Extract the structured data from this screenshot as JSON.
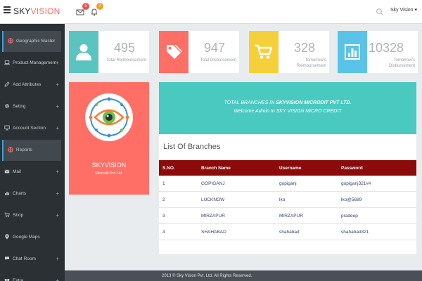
{
  "header": {
    "brand_part1": "SKY",
    "brand_part2": "VISION",
    "mail_count": "5",
    "bell_count": "7",
    "user_menu": "Sky Vision ▾"
  },
  "sidebar": {
    "items": [
      {
        "label": "Geographic Master",
        "icon": "globe-icon",
        "active": true,
        "expandable": false
      },
      {
        "label": "Product Management",
        "icon": "laptop-icon",
        "active": false,
        "expandable": true
      },
      {
        "label": "Add Attributes",
        "icon": "pencil-icon",
        "active": false,
        "expandable": true
      },
      {
        "label": "Seting",
        "icon": "gear-icon",
        "active": false,
        "expandable": true
      },
      {
        "label": "Account Section",
        "icon": "monitor-icon",
        "active": false,
        "expandable": true
      },
      {
        "label": "Reports",
        "icon": "globe-icon",
        "active": true,
        "expandable": false
      },
      {
        "label": "Mail",
        "icon": "envelope-icon",
        "active": false,
        "expandable": true
      },
      {
        "label": "Charts",
        "icon": "bar-chart-icon",
        "active": false,
        "expandable": true
      },
      {
        "label": "Shop",
        "icon": "cart-icon",
        "active": false,
        "expandable": true
      },
      {
        "label": "Google Maps",
        "icon": "map-pin-icon",
        "active": false,
        "expandable": false
      },
      {
        "label": "Chat Room",
        "icon": "chat-icon",
        "active": false,
        "expandable": true
      },
      {
        "label": "Extra",
        "icon": "gift-icon",
        "active": false,
        "expandable": true
      }
    ]
  },
  "stats": [
    {
      "value": "495",
      "label": "Total Reimbursement",
      "color": "#5cc4c0",
      "icon": "user-icon"
    },
    {
      "value": "947",
      "label": "Total Disbursement",
      "color": "#ff6f66",
      "icon": "tag-icon"
    },
    {
      "value": "328",
      "label": "Tomorrow's Reimbursement",
      "color": "#f5d03a",
      "icon": "cart-icon"
    },
    {
      "value": "10328",
      "label": "Tomorrow's Disbursement",
      "color": "#5ac3e8",
      "icon": "bar-chart-icon"
    }
  ],
  "profile": {
    "name": "SKYVISION",
    "subtitle": "Microdit Pvt Ltd.",
    "color": "#ff6f66"
  },
  "banner": {
    "line1_prefix": "TOTAL BRANCHES IN ",
    "line1_bold": "SKYVISION MICRODIT PVT LTD.",
    "line2": "Welcome Admin In SKY VISION MICRO CREDIT",
    "color": "#49c9c0"
  },
  "branches": {
    "title": "List Of Branches",
    "columns": [
      "S.NO.",
      "Branch Name",
      "Username",
      "Password"
    ],
    "rows": [
      [
        "1",
        "GOPIGANJ",
        "gopiganj",
        "gopiganj321##"
      ],
      [
        "2",
        "LUCKNOW",
        "lko",
        "lko@5689"
      ],
      [
        "3",
        "MIRZAPUR",
        "MIRZAPUR",
        "pradeep"
      ],
      [
        "4",
        "SHAHABAD",
        "shahabad",
        "shahabad321"
      ]
    ],
    "header_color": "#8b0a0a"
  },
  "footer": {
    "text": "2013 © Sky Vision Pvt. Ltd. All Rights Reserved."
  }
}
